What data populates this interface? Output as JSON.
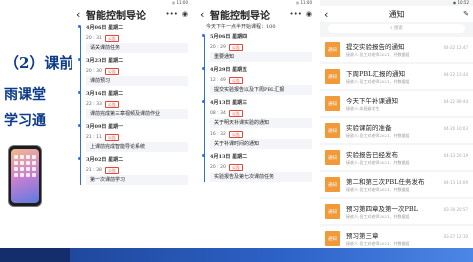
{
  "left": {
    "heading": "（2）课前",
    "line2": "雨课堂",
    "line3": "学习通"
  },
  "panel1": {
    "status_right": "◎ 11:00",
    "title": "智能控制导论",
    "days": [
      {
        "date": "4月06日 星期二",
        "time": "20 : 31",
        "tag": "公告",
        "text": "请关课前任务"
      },
      {
        "date": "3月23日 星期二",
        "time": "20 : 30",
        "tag": "公告",
        "text": "课前预习"
      },
      {
        "date": "3月16日 星期二",
        "time": "22 : 33",
        "tag": "公告",
        "text": "课前完成第三章视频及课前作业"
      },
      {
        "date": "3月09日 星期一",
        "time": "21 : 11",
        "tag": "公告",
        "text": "上课前完成智能导论系统"
      },
      {
        "date": "3月02日 星期二",
        "time": "21 : 38",
        "tag": "公告",
        "text": "第一次课前学习"
      }
    ]
  },
  "panel2": {
    "status_right": "◎ 11:00",
    "title": "智能控制导论",
    "sub": "今天下午一点半开始课程：100",
    "days": [
      {
        "date": "5月06日 星期四",
        "time": "20 : 29",
        "tag": "公告",
        "text": "重要通知"
      },
      {
        "date": "4月29日 星期五",
        "time": "12 : 49",
        "tag": "公告",
        "text": "提交实验报告以及下周PBL汇报"
      },
      {
        "date": "4月13日 星期三",
        "time": "08 : 34",
        "tag": "公告",
        "text": "关于明天补课实验的通知"
      },
      {
        "date": "",
        "time": "16 : 32",
        "tag": "公告",
        "text": "关于补课时间的通知"
      },
      {
        "date": "4月13日 星期二",
        "time": "20 : 20",
        "tag": "公告",
        "text": "实验报告及第七次课前任务"
      }
    ]
  },
  "panel3": {
    "status_right": "◉ 10:52",
    "title": "通知",
    "search_placeholder": "搜索",
    "icon_label": "通知",
    "items": [
      {
        "title": "提交实验报告的通知",
        "sub": "接收人:员工对老师2021、共数据组",
        "time": "04-22 12:47"
      },
      {
        "title": "下周PBL汇报的通知",
        "sub": "接收人:员工对老师2021、共数据组",
        "time": "04-22 13:44"
      },
      {
        "title": "今天下午补课通知",
        "sub": "接收人:本班级学生",
        "time": "04-22 09:44"
      },
      {
        "title": "实验课前的准备",
        "sub": "接收人:员工对老师2021、共数据组",
        "time": "04-20 10:03"
      },
      {
        "title": "实验报告已经发布",
        "sub": "接收人:员工对老师2021、共数据组",
        "time": "04-13 20:19"
      },
      {
        "title": "第二和第三次PBL任务发布",
        "sub": "接收人:员工对老师2021、共数据组",
        "time": "04-13 14:09"
      },
      {
        "title": "预习第四章及第一次PBL",
        "sub": "接收人:员工对老师2021、共数据组",
        "time": "03-30 20:57"
      },
      {
        "title": "预习第三章",
        "sub": "接收人:员工对老师2021、共数据组",
        "time": "03-27 12:10"
      }
    ]
  }
}
